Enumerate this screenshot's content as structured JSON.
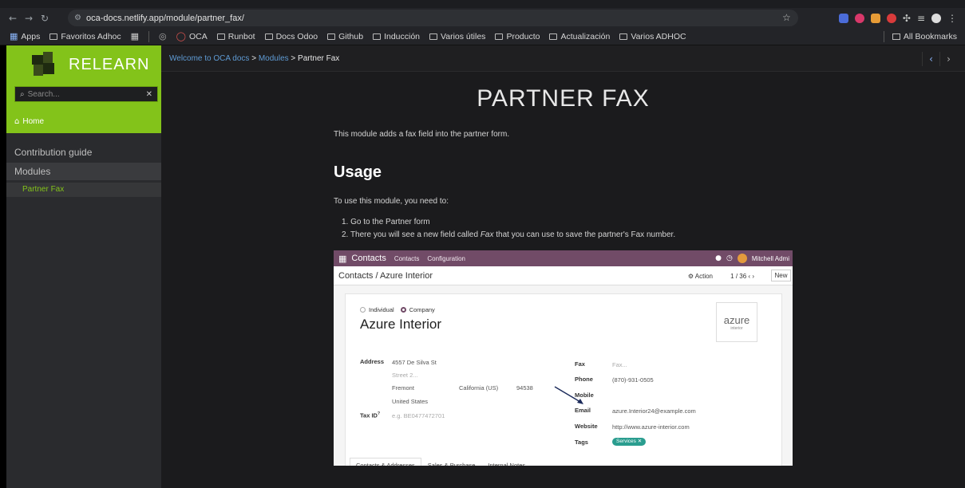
{
  "browser": {
    "url": "oca-docs.netlify.app/module/partner_fax/",
    "bookmarks": [
      "Apps",
      "Favoritos Adhoc",
      "OCA",
      "Runbot",
      "Docs Odoo",
      "Github",
      "Inducción",
      "Varios útiles",
      "Producto",
      "Actualización",
      "Varios ADHOC"
    ],
    "all_bookmarks": "All Bookmarks"
  },
  "sidebar": {
    "logo_text": "RELEARN",
    "search_placeholder": "Search...",
    "home_label": "Home",
    "items": [
      {
        "label": "Contribution guide"
      },
      {
        "label": "Modules"
      },
      {
        "label": "Partner Fax"
      }
    ]
  },
  "breadcrumb": {
    "root": "Welcome to OCA docs",
    "section": "Modules",
    "current": "Partner Fax",
    "separator": ">"
  },
  "page": {
    "title": "PARTNER FAX",
    "intro": "This module adds a fax field into the partner form.",
    "usage_heading": "Usage",
    "usage_intro": "To use this module, you need to:",
    "step1_num": "1.",
    "step1": "Go to the Partner form",
    "step2_num": "2.",
    "step2_pre": "There you will see a new field called ",
    "step2_em": "Fax",
    "step2_post": " that you can use to save the partner's Fax number."
  },
  "screenshot": {
    "brand": "Contacts",
    "menu": [
      "Contacts",
      "Configuration"
    ],
    "user": "Mitchell Admi",
    "breadcrumb": "Contacts / Azure Interior",
    "action": "Action",
    "count": "1 / 36",
    "new_label": "New",
    "radio_individual": "Individual",
    "radio_company": "Company",
    "company_name": "Azure Interior",
    "logo_main": "azure",
    "logo_sub": "interior",
    "address_label": "Address",
    "street": "4557 De Silva St",
    "street2": "Street 2...",
    "city": "Fremont",
    "state": "California (US)",
    "zip": "94538",
    "country": "United States",
    "taxid_label": "Tax ID",
    "taxid_sup": "?",
    "taxid_placeholder": "e.g. BE0477472701",
    "fax_label": "Fax",
    "fax_placeholder": "Fax...",
    "phone_label": "Phone",
    "phone": "(870)-931-0505",
    "mobile_label": "Mobile",
    "email_label": "Email",
    "email": "azure.Interior24@example.com",
    "website_label": "Website",
    "website": "http://www.azure-interior.com",
    "tags_label": "Tags",
    "tag": "Services",
    "tabs": [
      "Contacts & Addresses",
      "Sales & Purchase",
      "Internal Notes"
    ]
  },
  "colors": {
    "relearn_green": "#83c31a",
    "link_blue": "#5f9bd4",
    "odoo_purple": "#714b67"
  }
}
